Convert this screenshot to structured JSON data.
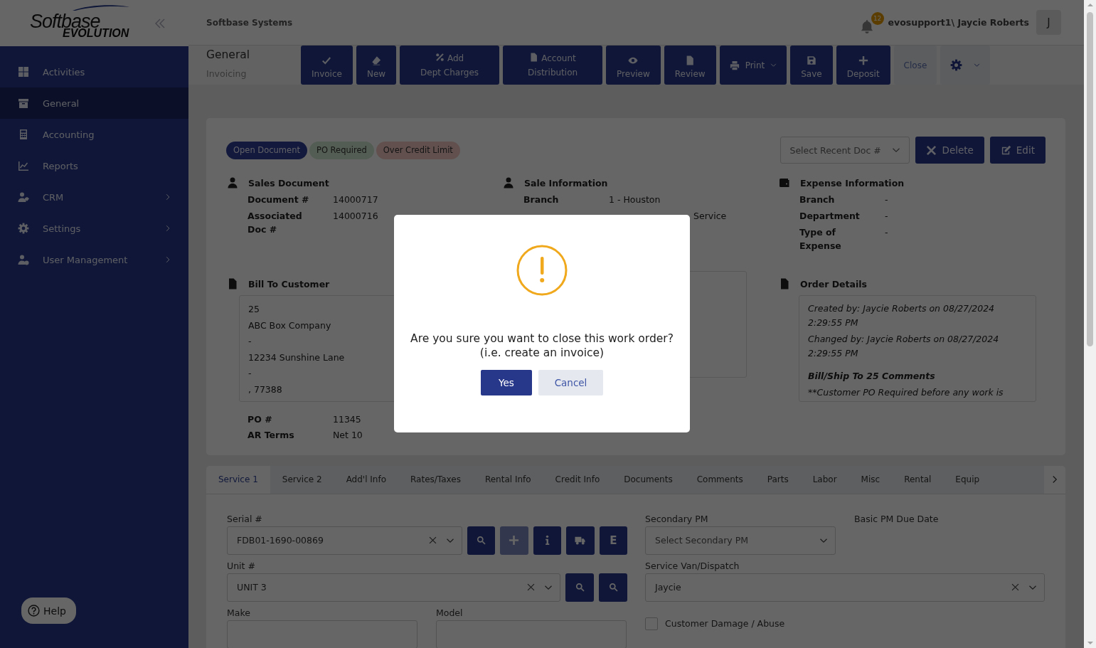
{
  "sidebar": {
    "logo": {
      "wordmark": "Softbase",
      "subtitle": "EVOLUTION"
    },
    "items": [
      {
        "label": "Activities",
        "selected": false,
        "expandable": false
      },
      {
        "label": "General",
        "selected": true,
        "expandable": false
      },
      {
        "label": "Accounting",
        "selected": false,
        "expandable": false
      },
      {
        "label": "Reports",
        "selected": false,
        "expandable": false
      },
      {
        "label": "CRM",
        "selected": false,
        "expandable": true
      },
      {
        "label": "Settings",
        "selected": false,
        "expandable": true
      },
      {
        "label": "User Management",
        "selected": false,
        "expandable": true
      }
    ],
    "help_button": "Help"
  },
  "header": {
    "company": "Softbase Systems",
    "notification_count": "12",
    "user": "evosupport1\\ Jaycie Roberts",
    "avatar": "J"
  },
  "page": {
    "title": "General",
    "subtitle": "Invoicing"
  },
  "toolbar": [
    {
      "label": "Invoice",
      "kind": "stacked"
    },
    {
      "label": "New",
      "kind": "stacked"
    },
    {
      "label": "Add Dept Charges",
      "kind": "inline"
    },
    {
      "label": "Account Distribution",
      "kind": "inline"
    },
    {
      "label": "Preview",
      "kind": "stacked"
    },
    {
      "label": "Review",
      "kind": "stacked"
    },
    {
      "label": "Print",
      "kind": "dropdown"
    },
    {
      "label": "Save",
      "kind": "stacked"
    },
    {
      "label": "Deposit",
      "kind": "stacked"
    },
    {
      "label": "Close",
      "kind": "light"
    },
    {
      "kind": "menu"
    }
  ],
  "document": {
    "status_badges": [
      {
        "label": "Open Document",
        "kind": "status"
      },
      {
        "label": "PO Required",
        "kind": "success"
      },
      {
        "label": "Over Credit Limit",
        "kind": "danger"
      }
    ],
    "recent_doc": {
      "placeholder": "Select Recent Doc #"
    },
    "actions": [
      {
        "label": "Delete"
      },
      {
        "label": "Edit"
      }
    ],
    "sections": [
      {
        "title": "Sales Document",
        "fields": [
          {
            "label": "Document #",
            "value": "14000717"
          },
          {
            "label": "Associated Doc #",
            "value": "14000716"
          }
        ]
      },
      {
        "title": "Sale Information",
        "fields": [
          {
            "label": "Branch",
            "value": "1 - Houston"
          }
        ],
        "fragment": "Service"
      },
      {
        "title": "Expense Information",
        "fields": [
          {
            "label": "Branch",
            "value": "-"
          },
          {
            "label": "Department",
            "value": "-"
          },
          {
            "label": "Type of Expense",
            "value": "-"
          }
        ]
      }
    ],
    "bill_to": {
      "title": "Bill To Customer",
      "lines": [
        "25",
        "ABC Box Company",
        "-",
        "12234 Sunshine Lane",
        "-",
        ", 77388"
      ]
    },
    "terms": [
      {
        "label": "PO #",
        "value": "11345"
      },
      {
        "label": "AR Terms",
        "value": "Net 10"
      }
    ],
    "order_details": {
      "title": "Order Details",
      "entries": [
        {
          "text": "Created by: Jaycie Roberts on 08/27/2024 2:29:55 PM",
          "kind": "note"
        },
        {
          "text": "Changed by: Jaycie Roberts on 08/27/2024 2:29:55 PM",
          "kind": "note"
        },
        {
          "text": "Bill/Ship To 25 Comments",
          "kind": "heading"
        },
        {
          "text": "**Customer PO Required before any work is",
          "kind": "note"
        }
      ]
    }
  },
  "tabs": [
    {
      "label": "Service 1",
      "selected": true
    },
    {
      "label": "Service 2",
      "selected": false
    },
    {
      "label": "Add'l Info",
      "selected": false
    },
    {
      "label": "Rates/Taxes",
      "selected": false
    },
    {
      "label": "Rental Info",
      "selected": false
    },
    {
      "label": "Credit Info",
      "selected": false
    },
    {
      "label": "Documents",
      "selected": false
    },
    {
      "label": "Comments",
      "selected": false
    },
    {
      "label": "Parts",
      "selected": false
    },
    {
      "label": "Labor",
      "selected": false
    },
    {
      "label": "Misc",
      "selected": false
    },
    {
      "label": "Rental",
      "selected": false
    },
    {
      "label": "Equip",
      "selected": false
    }
  ],
  "form": {
    "serial": {
      "label": "Serial #",
      "value": "FDB01-1690-00869",
      "buttons": [
        {
          "disabled": false
        },
        {
          "disabled": true
        },
        {
          "disabled": false
        },
        {
          "disabled": false
        },
        {
          "text": "E",
          "disabled": false
        }
      ]
    },
    "secondary_pm": {
      "label": "Secondary PM",
      "placeholder": "Select Secondary PM"
    },
    "basic_pm_due": {
      "label": "Basic PM Due Date"
    },
    "unit": {
      "label": "Unit #",
      "value": "UNIT 3",
      "buttons": [
        {
          "disabled": false
        },
        {
          "disabled": false
        }
      ]
    },
    "service_van": {
      "label": "Service Van/Dispatch",
      "value": "Jaycie"
    },
    "make": {
      "label": "Make"
    },
    "model": {
      "label": "Model"
    },
    "damage": {
      "label": "Customer Damage / Abuse",
      "checked": false
    }
  },
  "dialog": {
    "message": [
      "Are you sure you want to close this work order?",
      "(i.e. create an invoice)"
    ],
    "buttons": [
      {
        "label": "Yes",
        "kind": "primary"
      },
      {
        "label": "Cancel",
        "kind": "secondary"
      }
    ]
  }
}
